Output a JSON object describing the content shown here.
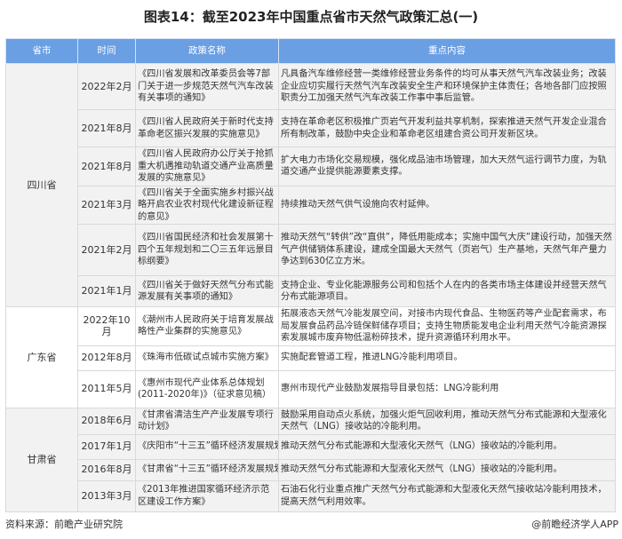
{
  "title": "图表14：截至2023年中国重点省市天然气政策汇总(一)",
  "table": {
    "headers": [
      "省市",
      "时间",
      "政策名称",
      "重点内容"
    ],
    "groups": [
      {
        "province": "四川省",
        "rows": [
          {
            "time": "2022年2月",
            "policy": "《四川省发展和改革委员会等7部门关于进一步规范天然气汽车改装有关事项的通知》",
            "content": "凡具备汽车维修经营一类维修经营业务条件的均可从事天然气汽车改装业务；改装企业应切实履行天然气汽车改装安全生产和环境保护主体责任；各地各部门应按照职责分工加强天然气汽车改装工作事中事后监管。"
          },
          {
            "time": "2021年8月",
            "policy": "《四川省人民政府关于新时代支持革命老区振兴发展的实施意见》",
            "content": "支持在革命老区积极推广页岩气开发利益共享机制，探索推进天然气开发企业混合所有制改革，鼓励中央企业和革命老区组建合资公司开发新区块。"
          },
          {
            "time": "2021年8月",
            "policy": "《四川省人民政府办公厅关于抢抓重大机遇推动轨道交通产业高质量发展的实施意见》",
            "content": "扩大电力市场化交易规模，强化成品油市场管理，加大天然气运行调节力度，为轨道交通产业提供能源要素支撑。"
          },
          {
            "time": "2021年3月",
            "policy": "《四川省关于全面实施乡村振兴战略开启农业农村现代化建设新征程的意见》",
            "content": "持续推动天然气供气设施向农村延伸。"
          },
          {
            "time": "2021年2月",
            "policy": "《四川省国民经济和社会发展第十四个五年规划和二〇三五年远景目标纲要》",
            "content": "推动天然气“转供”改“直供”，降低用能成本；实施中国气大庆”建设行动，加强天然气产供储销体系建设，建成全国最大天然气（页岩气）生产基地，天然气年产量力争达到630亿立方米。"
          },
          {
            "time": "2021年1月",
            "policy": "《四川省关于做好天然气分布式能源发展有关事项的通知》",
            "content": "支持企业、专业化能源服务公司和包括个人在内的各类市场主体建设并经营天然气分布式能源项目。"
          }
        ]
      },
      {
        "province": "广东省",
        "rows": [
          {
            "time": "2022年10月",
            "policy": "《潮州市人民政府关于培育发展战略性产业集群的实施意见》",
            "content": "拓展液态天然气冷能发展空间，对接市内现代食品、生物医药等产业配套需求，布局发展食品药品冷链保鲜储存项目；支持生物质能发电企业利用天然气冷能资源探索发展城市废弃物低温粉碎技术，提升资源循环利用水平。"
          },
          {
            "time": "2012年8月",
            "policy": "《珠海市低碳试点城市实施方案》",
            "content": "实施配套管道工程，推进LNG冷能利用项目。"
          },
          {
            "time": "2011年5月",
            "policy": "《惠州市现代产业体系总体规划(2011-2020年)》（征求意见稿）",
            "content": "惠州市现代产业鼓励发展指导目录包括：LNG冷能利用"
          }
        ]
      },
      {
        "province": "甘肃省",
        "rows": [
          {
            "time": "2018年6月",
            "policy": "《甘肃省清洁生产产业发展专项行动计划》",
            "content": "鼓励采用自动点火系统，加强火炬气回收利用，推动天然气分布式能源和大型液化天然气（LNG）接收站的冷能利用。"
          },
          {
            "time": "2017年1月",
            "policy": "《庆阳市“十三五”循环经济发展规划",
            "content": "推动天然气分布式能源和大型液化天然气（LNG）接收站的冷能利用。"
          },
          {
            "time": "2016年8月",
            "policy": "《甘肃省“十三五”循环经济发展规划",
            "content": "推动天然气分布式能源和大型液化天然气（LNG）接收站的冷能利用。"
          },
          {
            "time": "2013年3月",
            "policy": "《2013年推进国家循环经济示范区建设工作方案》",
            "content": "石油石化行业重点推广天然气分布式能源和大型液化天然气接收站冷能利用技术，提高天然气利用效率。"
          }
        ]
      }
    ]
  },
  "footer": {
    "source": "资料来源：前瞻产业研究院",
    "credit": "@前瞻经济学人APP"
  },
  "colors": {
    "header_bg": "#6a9fe3",
    "row_gray": "#f2f2f2"
  }
}
